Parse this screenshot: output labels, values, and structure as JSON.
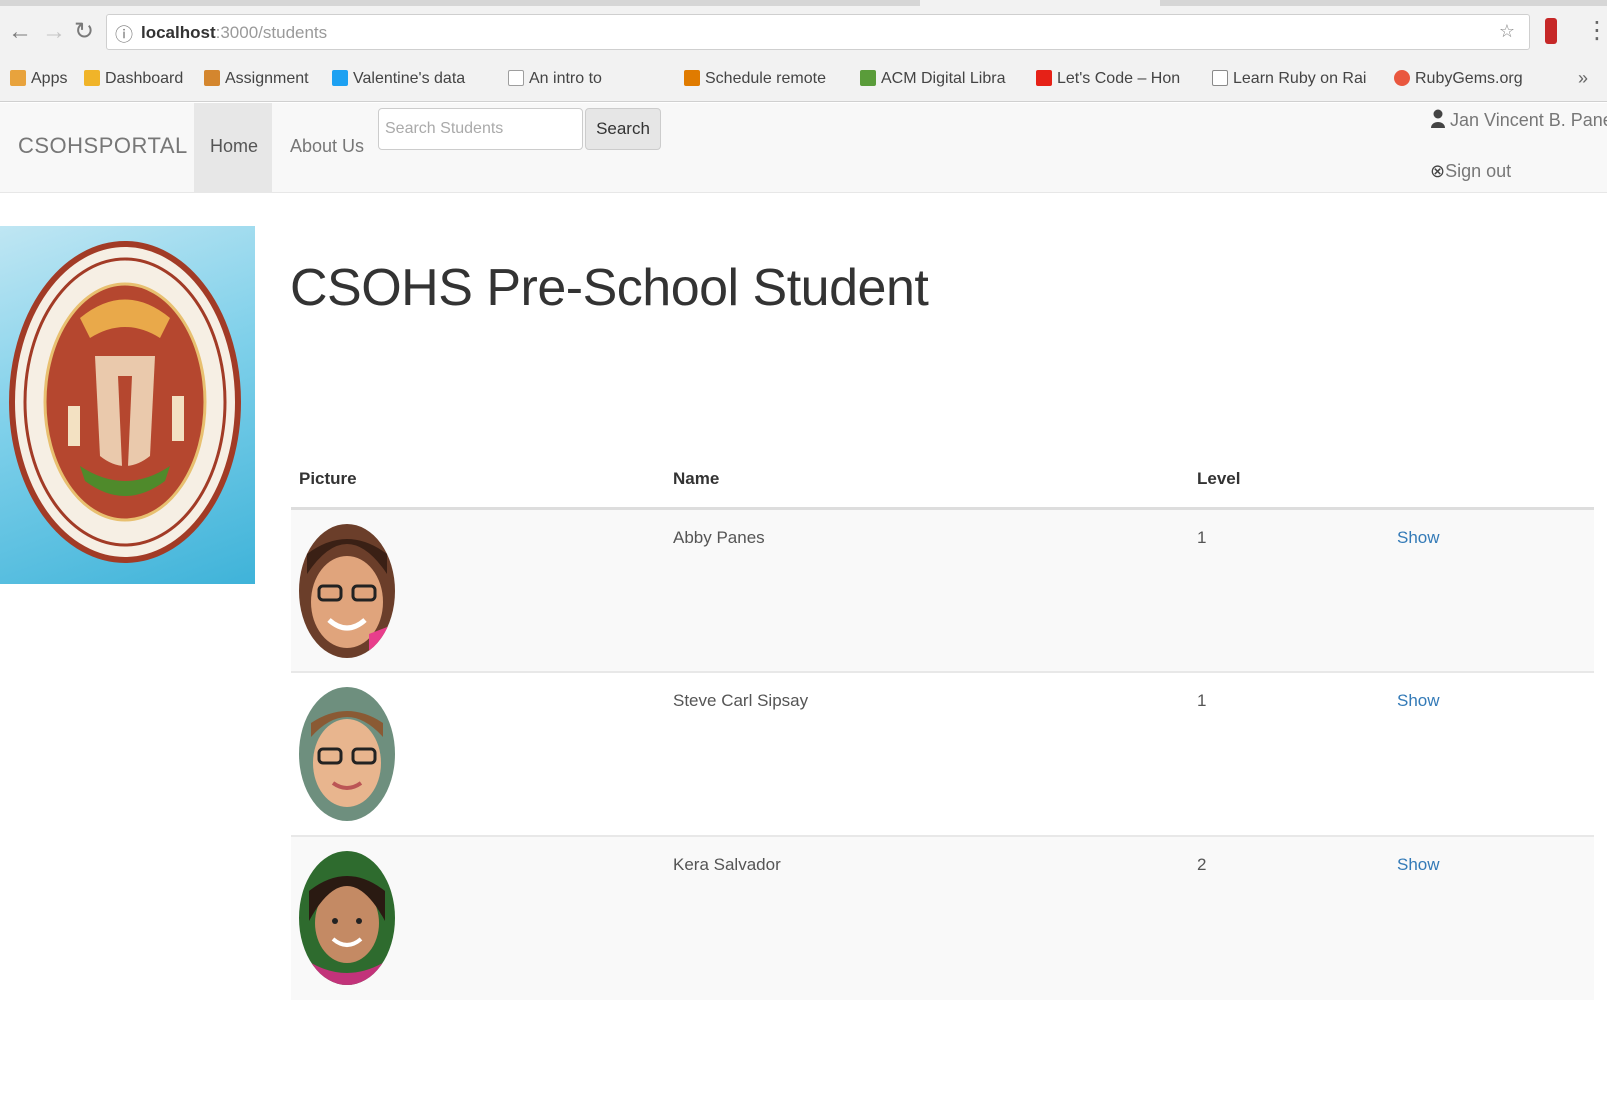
{
  "browser": {
    "url_host": "localhost",
    "url_path": ":3000/students",
    "bookmarks": [
      {
        "label": "Apps",
        "icon": "apps-grid-icon",
        "color": "#e8a33d"
      },
      {
        "label": "Dashboard",
        "icon": "dashboard-icon",
        "color": "#f0b429"
      },
      {
        "label": "Assignment",
        "icon": "assignment-icon",
        "color": "#d4862e"
      },
      {
        "label": "Valentine's data",
        "icon": "twitter-icon",
        "color": "#1da1f2"
      },
      {
        "label": "An intro to",
        "icon": "page-icon",
        "color": "#9e9e9e"
      },
      {
        "label": "Schedule remote",
        "icon": "schedule-icon",
        "color": "#e07b00"
      },
      {
        "label": "ACM Digital Libra",
        "icon": "acm-icon",
        "color": "#5a9c3a"
      },
      {
        "label": "Let's Code – Hon",
        "icon": "youtube-icon",
        "color": "#e62117"
      },
      {
        "label": "Learn Ruby on Rai",
        "icon": "rails-icon",
        "color": "#8a8a8a"
      },
      {
        "label": "RubyGems.org",
        "icon": "rubygems-icon",
        "color": "#e9573f"
      }
    ]
  },
  "navbar": {
    "brand": "CSOHSPORTAL",
    "home": "Home",
    "about": "About Us",
    "search_placeholder": "Search Students",
    "search_button": "Search",
    "user_name": "Jan Vincent B. Panes",
    "sign_out": "Sign out"
  },
  "page": {
    "title": "CSOHS Pre-School Student"
  },
  "table": {
    "headers": [
      "Picture",
      "Name",
      "Level",
      ""
    ],
    "rows": [
      {
        "name": "Abby Panes",
        "level": "1",
        "action": "Show"
      },
      {
        "name": "Steve Carl Sipsay",
        "level": "1",
        "action": "Show"
      },
      {
        "name": "Kera Salvador",
        "level": "2",
        "action": "Show"
      }
    ]
  }
}
